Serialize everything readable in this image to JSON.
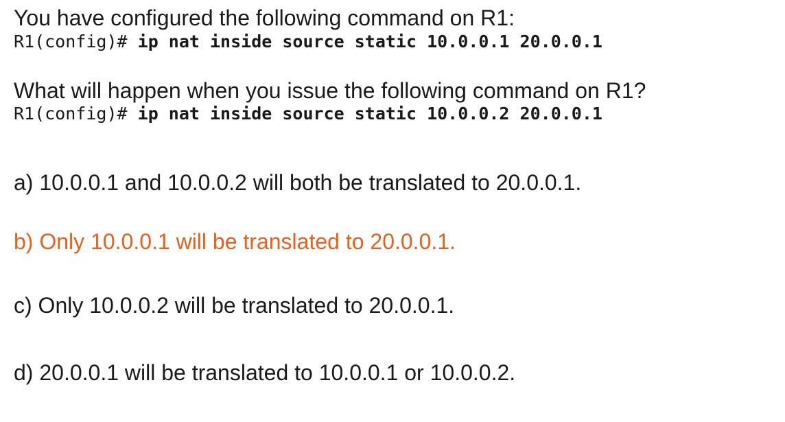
{
  "question": {
    "intro": "You have configured the following command on R1:",
    "config_prompt_1": "R1(config)#",
    "config_cmd_1": "ip nat inside source static 10.0.0.1 20.0.0.1",
    "ask": "What will happen when you issue the following command on R1?",
    "config_prompt_2": "R1(config)#",
    "config_cmd_2": "ip nat inside source static 10.0.0.2 20.0.0.1"
  },
  "options": [
    {
      "text": "a) 10.0.0.1 and 10.0.0.2 will both be translated to 20.0.0.1."
    },
    {
      "text": "b) Only 10.0.0.1 will be translated to 20.0.0.1."
    },
    {
      "text": "c) Only 10.0.0.2 will be translated to 20.0.0.1."
    },
    {
      "text": "d) 20.0.0.1 will be translated to 10.0.0.1 or 10.0.0.2."
    }
  ],
  "colors": {
    "text": "#1a1a1a",
    "correct_answer": "#e8601c",
    "background": "#ffffff"
  }
}
